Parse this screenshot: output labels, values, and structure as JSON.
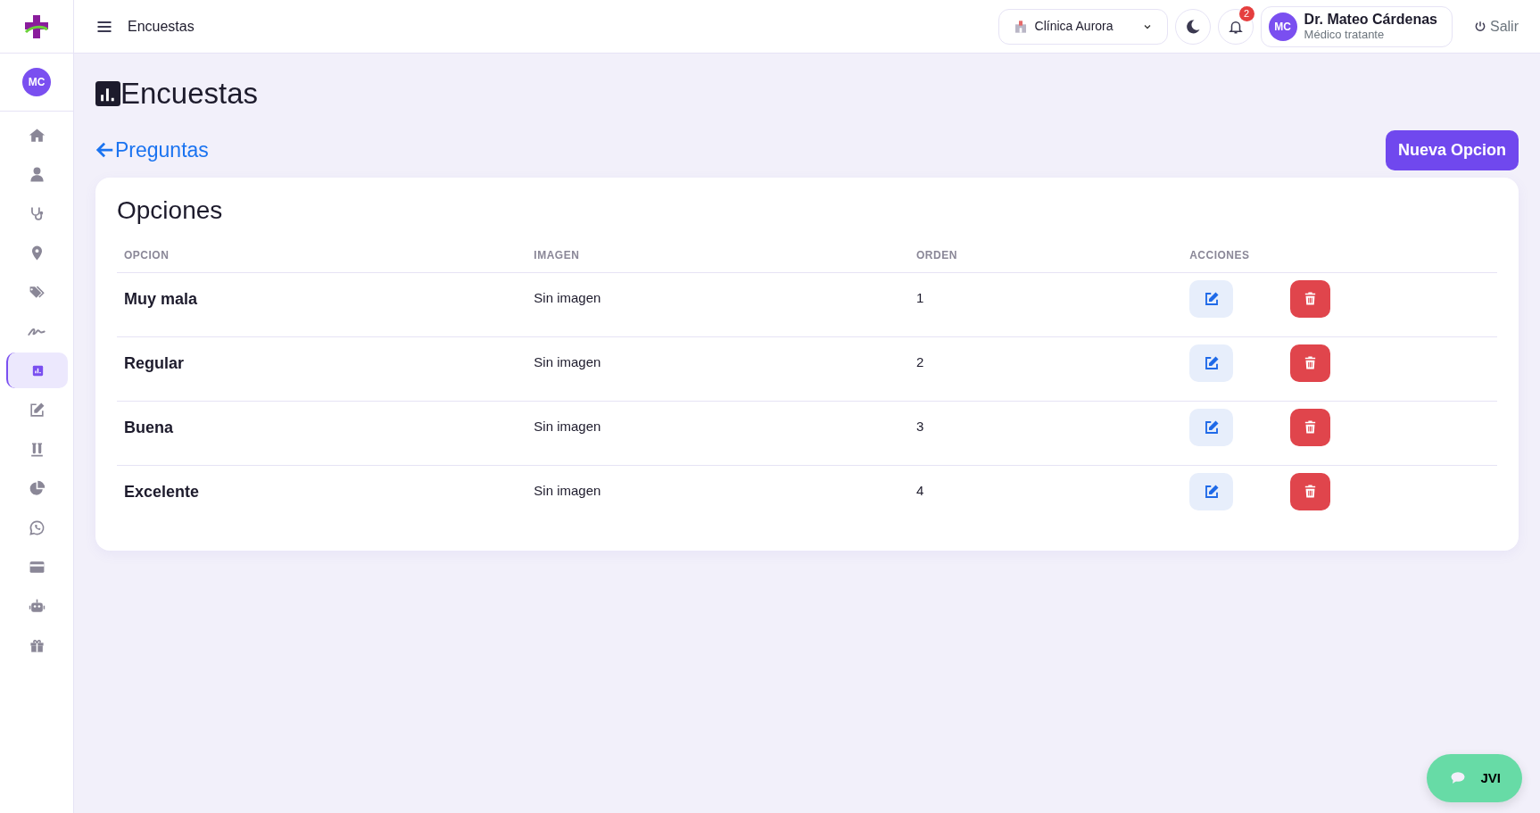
{
  "topbar": {
    "title": "Encuestas",
    "clinic_select": {
      "value": "Clínica Aurora"
    },
    "notifications": {
      "count": "2"
    },
    "user": {
      "initials": "MC",
      "name": "Dr. Mateo Cárdenas",
      "role": "Médico tratante"
    },
    "logout": "Salir"
  },
  "sidebar": {
    "avatar": "MC",
    "items": [
      {
        "selected": false
      },
      {
        "selected": false
      },
      {
        "selected": false
      },
      {
        "selected": false
      },
      {
        "selected": false
      },
      {
        "selected": false
      },
      {
        "selected": true
      },
      {
        "selected": false
      },
      {
        "selected": false
      },
      {
        "selected": false
      },
      {
        "selected": false
      },
      {
        "selected": false
      },
      {
        "selected": false
      },
      {
        "selected": false
      }
    ]
  },
  "page": {
    "title": "Encuestas",
    "back_link": "Preguntas",
    "new_button": "Nueva Opcion"
  },
  "card": {
    "title": "Opciones",
    "columns": [
      "OPCION",
      "IMAGEN",
      "ORDEN",
      "ACCIONES"
    ],
    "rows": [
      {
        "option": "Muy mala",
        "image": "Sin imagen",
        "order": "1"
      },
      {
        "option": "Regular",
        "image": "Sin imagen",
        "order": "2"
      },
      {
        "option": "Buena",
        "image": "Sin imagen",
        "order": "3"
      },
      {
        "option": "Excelente",
        "image": "Sin imagen",
        "order": "4"
      }
    ]
  },
  "chat_button": {
    "label": "JVI"
  }
}
